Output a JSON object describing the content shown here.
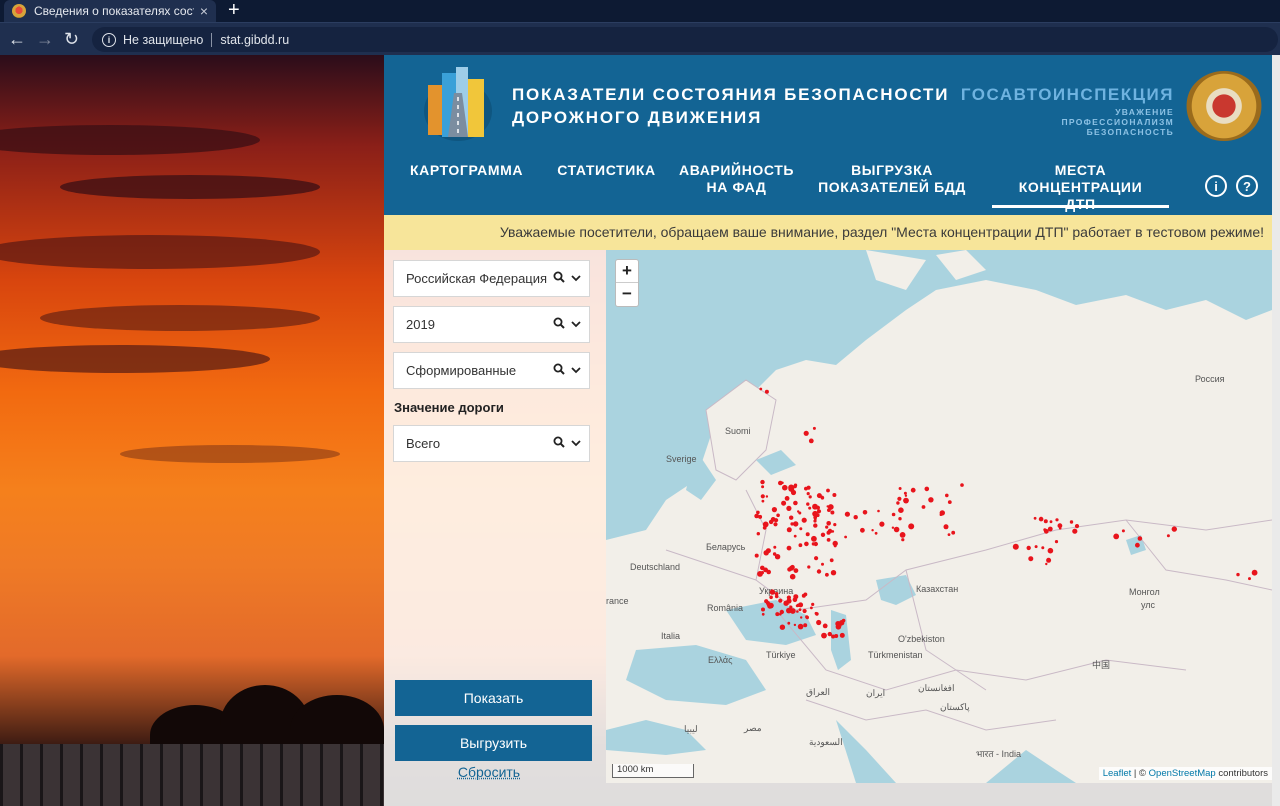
{
  "browser": {
    "tab_title": "Сведения о показателях состоя",
    "tab_close": "×",
    "new_tab": "+",
    "back": "←",
    "forward": "→",
    "reload": "↻",
    "security": "Не защищено",
    "url": "stat.gibdd.ru"
  },
  "header": {
    "title_line1": "ПОКАЗАТЕЛИ СОСТОЯНИЯ БЕЗОПАСНОСТИ",
    "title_line2": "ДОРОЖНОГО ДВИЖЕНИЯ",
    "org_name": "ГОСАВТОИНСПЕКЦИЯ",
    "motto1": "УВАЖЕНИЕ",
    "motto2": "ПРОФЕССИОНАЛИЗМ",
    "motto3": "БЕЗОПАСНОСТЬ"
  },
  "nav": {
    "items": [
      {
        "line1": "КАРТОГРАММА",
        "line2": ""
      },
      {
        "line1": "СТАТИСТИКА",
        "line2": ""
      },
      {
        "line1": "АВАРИЙНОСТЬ",
        "line2": "НА ФАД"
      },
      {
        "line1": "ВЫГРУЗКА",
        "line2": "ПОКАЗАТЕЛЕЙ БДД"
      },
      {
        "line1": "МЕСТА КОНЦЕНТРАЦИИ",
        "line2": "ДТП"
      }
    ],
    "active": "МЕСТА КОНЦЕНТРАЦИИ ДТП",
    "info_icon": "i",
    "help_icon": "?"
  },
  "notice": "Уважаемые посетители, обращаем ваше внимание, раздел \"Места концентрации ДТП\" работает в тестовом режиме!",
  "filters": {
    "region": "Российская Федерация",
    "year": "2019",
    "status": "Сформированные",
    "road_value_label": "Значение дороги",
    "road_value": "Всего",
    "search_glyph": "🔍",
    "chevron_glyph": "⌄"
  },
  "actions": {
    "show": "Показать",
    "export": "Выгрузить",
    "reset": "Сбросить"
  },
  "map": {
    "zoom_in": "+",
    "zoom_out": "−",
    "scale": "1000 km",
    "attr_leaflet": "Leaflet",
    "attr_sep": " | © ",
    "attr_osm": "OpenStreetMap",
    "attr_contrib": " contributors",
    "labels": {
      "rossiya": "Россия",
      "suomi": "Suomi",
      "sverige": "Sverige",
      "belarus": "Беларусь",
      "deutschland": "Deutschland",
      "france": "rance",
      "ukraina": "Украина",
      "romania": "România",
      "italia": "Italia",
      "ellas": "Ελλάς",
      "turkiye": "Türkiye",
      "kazakhstan": "Казахстан",
      "uzbekistan": "O'zbekiston",
      "turkmenistan": "Türkmenistan",
      "mongol": "Монгол",
      "uls": "улс",
      "china": "中国",
      "iraq": "العراق",
      "iran": "ایران",
      "afghanistan": "افغانستان",
      "pakistan": "پاکستان",
      "saudi": "السعودية",
      "misr": "مصر",
      "libya": "ليبيا",
      "bharat": "भारत - India"
    },
    "dot_color": "#e8141c",
    "water_color": "#aad3df",
    "land_color": "#f2efe9"
  }
}
